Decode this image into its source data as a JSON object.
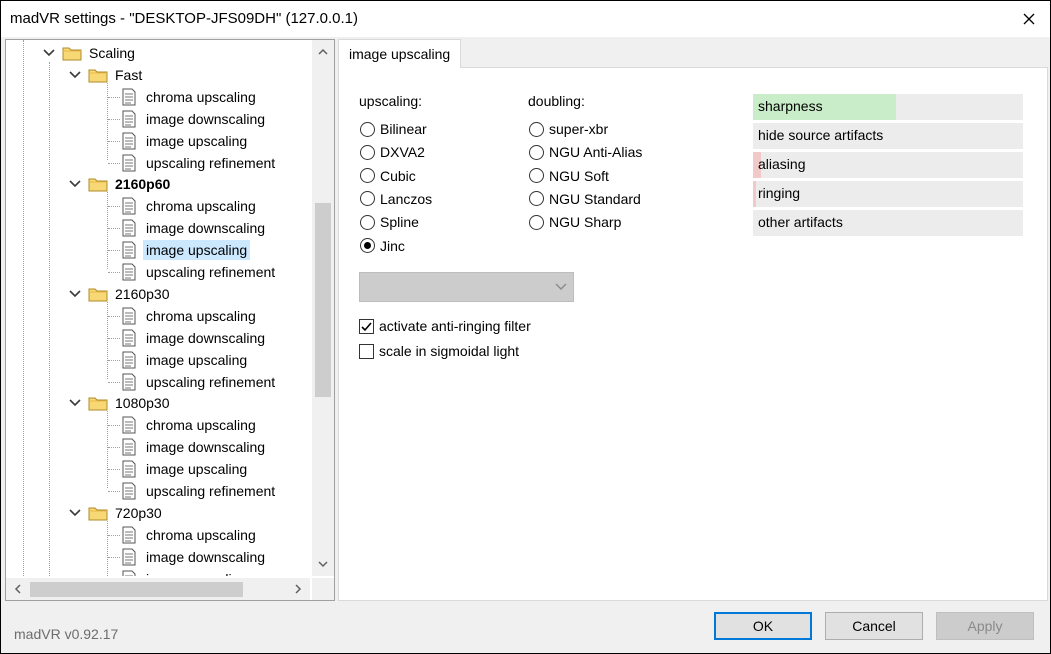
{
  "window": {
    "title": "madVR settings - \"DESKTOP-JFS09DH\" (127.0.0.1)"
  },
  "tree": {
    "root": "Scaling",
    "groups": [
      {
        "name": "Fast",
        "bold": false,
        "items": [
          "chroma upscaling",
          "image downscaling",
          "image upscaling",
          "upscaling refinement"
        ]
      },
      {
        "name": "2160p60",
        "bold": true,
        "items": [
          "chroma upscaling",
          "image downscaling",
          "image upscaling",
          "upscaling refinement"
        ]
      },
      {
        "name": "2160p30",
        "bold": false,
        "items": [
          "chroma upscaling",
          "image downscaling",
          "image upscaling",
          "upscaling refinement"
        ]
      },
      {
        "name": "1080p30",
        "bold": false,
        "items": [
          "chroma upscaling",
          "image downscaling",
          "image upscaling",
          "upscaling refinement"
        ]
      },
      {
        "name": "720p30",
        "bold": false,
        "items": [
          "chroma upscaling",
          "image downscaling",
          "image upscaling"
        ]
      }
    ],
    "selected": "2160p60 / image upscaling"
  },
  "tab": {
    "label": "image upscaling"
  },
  "upscaling": {
    "label": "upscaling:",
    "options": [
      "Bilinear",
      "DXVA2",
      "Cubic",
      "Lanczos",
      "Spline",
      "Jinc"
    ],
    "selected": "Jinc"
  },
  "doubling": {
    "label": "doubling:",
    "options": [
      "super-xbr",
      "NGU Anti-Alias",
      "NGU Soft",
      "NGU Standard",
      "NGU Sharp"
    ]
  },
  "combo": {
    "value": ""
  },
  "checkboxes": [
    {
      "label": "activate anti-ringing filter",
      "checked": true
    },
    {
      "label": "scale in sigmoidal light",
      "checked": false
    }
  ],
  "quality_bars": [
    {
      "label": "sharpness",
      "level": 0.53,
      "color": "#c9ecc9"
    },
    {
      "label": "hide source artifacts",
      "level": 0.0,
      "color": "#f2c9c9"
    },
    {
      "label": "aliasing",
      "level": 0.03,
      "color": "#f2c9c9"
    },
    {
      "label": "ringing",
      "level": 0.01,
      "color": "#f2c9c9"
    },
    {
      "label": "other artifacts",
      "level": 0.0,
      "color": "#f2c9c9"
    }
  ],
  "footer": {
    "version": "madVR v0.92.17",
    "ok": "OK",
    "cancel": "Cancel",
    "apply": "Apply"
  },
  "colors": {
    "accent": "#0078d7",
    "selection": "#cce8ff"
  }
}
